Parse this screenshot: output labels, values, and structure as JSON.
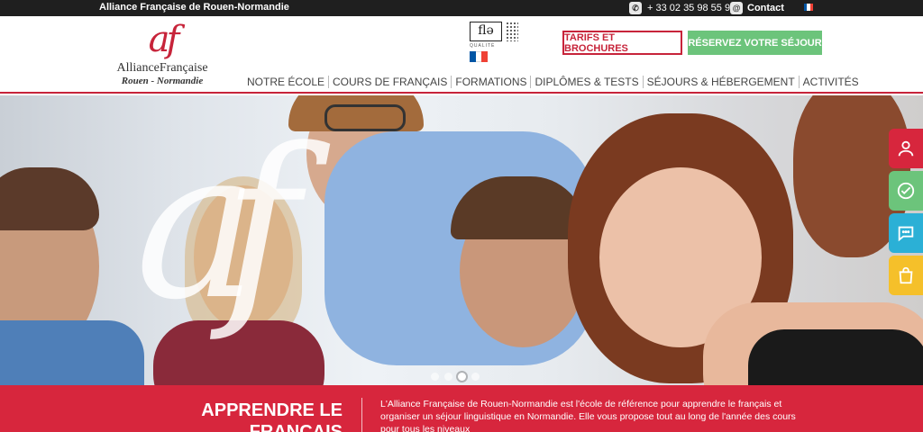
{
  "topbar": {
    "site_name": "Alliance Française de Rouen-Normandie",
    "phone": "+ 33 02 35 98 55 99",
    "contact": "Contact",
    "flag_colors": [
      "#0055a4",
      "#ffffff",
      "#ef4135"
    ]
  },
  "logo": {
    "mark": "af",
    "brand": "AllianceFrançaise",
    "sub": "Rouen - Normandie"
  },
  "fle": {
    "mark": "flə",
    "label": "QUALITÉ"
  },
  "header": {
    "tarifs_label": "TARIFS ET BROCHURES",
    "sejour_label": "RÉSERVEZ VOTRE SÉJOUR"
  },
  "nav": {
    "items": [
      "NOTRE ÉCOLE",
      "COURS DE FRANÇAIS",
      "FORMATIONS",
      "DIPLÔMES & TESTS",
      "SÉJOURS & HÉBERGEMENT",
      "ACTIVITÉS"
    ]
  },
  "hero": {
    "watermark": "af",
    "slides": 4,
    "active_slide": 3
  },
  "side_tabs": [
    {
      "icon": "user-icon",
      "color": "#d7263d"
    },
    {
      "icon": "check-icon",
      "color": "#6cc47b"
    },
    {
      "icon": "chat-icon",
      "color": "#2bb0d6"
    },
    {
      "icon": "shopping-bag-icon",
      "color": "#f5c02a"
    }
  ],
  "band": {
    "title": "APPRENDRE LE FRANÇAIS",
    "text": "L'Alliance Française de Rouen-Normandie est l'école de référence pour apprendre le français et organiser un séjour linguistique en Normandie. Elle vous propose tout au long de l'année des cours pour tous les niveaux"
  },
  "colors": {
    "brand_red": "#c7243a",
    "band_red": "#d7263d",
    "green": "#6cc47b",
    "topbar": "#1f1f1f"
  }
}
